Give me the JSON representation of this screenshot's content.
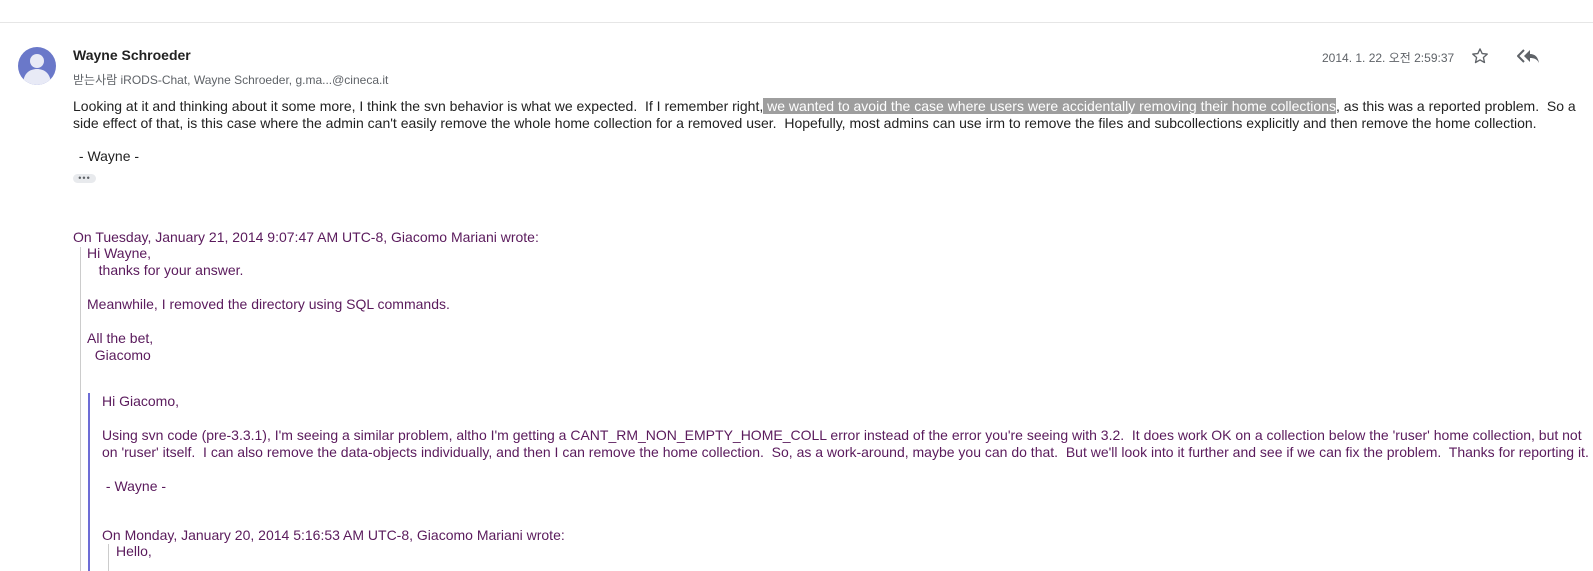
{
  "message": {
    "sender": "Wayne Schroeder",
    "recipients": "받는사람 iRODS-Chat, Wayne Schroeder, g.ma...@cineca.it",
    "date": "2014. 1. 22. 오전 2:59:37",
    "icons": {
      "avatar": "person-avatar-icon",
      "star": "star-outline-icon",
      "reply": "reply-all-icon",
      "more": "ellipsis-icon"
    },
    "body": {
      "part1": "Looking at it and thinking about it some more, I think the svn behavior is what we expected.  If I remember right,",
      "highlight": " we wanted to avoid the case where users were accidentally removing their home collections",
      "part2": ", as this was a reported problem.  So a side effect of that, is this case where the admin can't easily remove the whole home collection for a removed user.  Hopefully, most admins can use irm to remove the files and subcollections explicitly and then remove the home collection."
    },
    "signature": " - Wayne -",
    "more_label": "•••"
  },
  "quote1": {
    "attribution": "On Tuesday, January 21, 2014 9:07:47 AM UTC-8, Giacomo Mariani wrote:",
    "text": "Hi Wayne,\n   thanks for your answer.\n\nMeanwhile, I removed the directory using SQL commands.\n\nAll the bet,\n  Giacomo"
  },
  "quote2": {
    "text": "Hi Giacomo,\n\nUsing svn code (pre-3.3.1), I'm seeing a similar problem, altho I'm getting a CANT_RM_NON_EMPTY_HOME_COLL error instead of the error you're seeing with 3.2.  It does work OK on a collection below the 'ruser' home collection, but not on 'ruser' itself.  I can also remove the data-objects individually, and then I can remove the home collection.  So, as a work-around, maybe you can do that.  But we'll look into it further and see if we can fix the problem.  Thanks for reporting it.\n\n - Wayne -",
    "attribution": "On Monday, January 20, 2014 5:16:53 AM UTC-8, Giacomo Mariani wrote:"
  },
  "quote3": {
    "text": "Hello,"
  },
  "colors": {
    "avatar_bg": "#6a78c9",
    "quote_text": "#5a1a5c",
    "highlight_bg": "#9e9e9e",
    "quote_bar_blue": "#6d6dd6"
  }
}
